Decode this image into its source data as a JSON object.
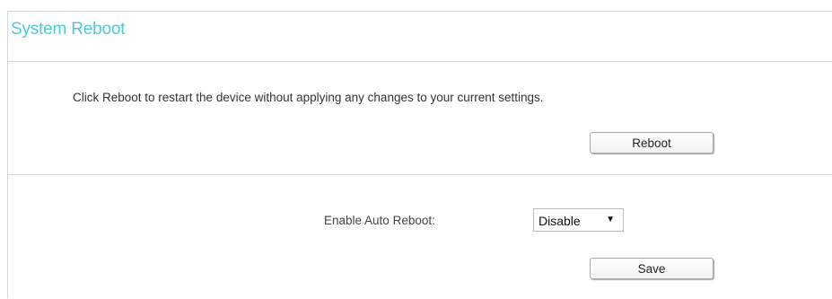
{
  "page": {
    "title": "System Reboot"
  },
  "reboot": {
    "description": "Click Reboot to restart the device without applying any changes to your current settings.",
    "button_label": "Reboot"
  },
  "auto_reboot": {
    "label": "Enable Auto Reboot:",
    "selected": "Disable",
    "save_label": "Save"
  },
  "icons": {
    "dropdown_arrow": "triangle-down-icon"
  },
  "colors": {
    "title": "#4acbd6",
    "border": "#d6d6d6"
  }
}
